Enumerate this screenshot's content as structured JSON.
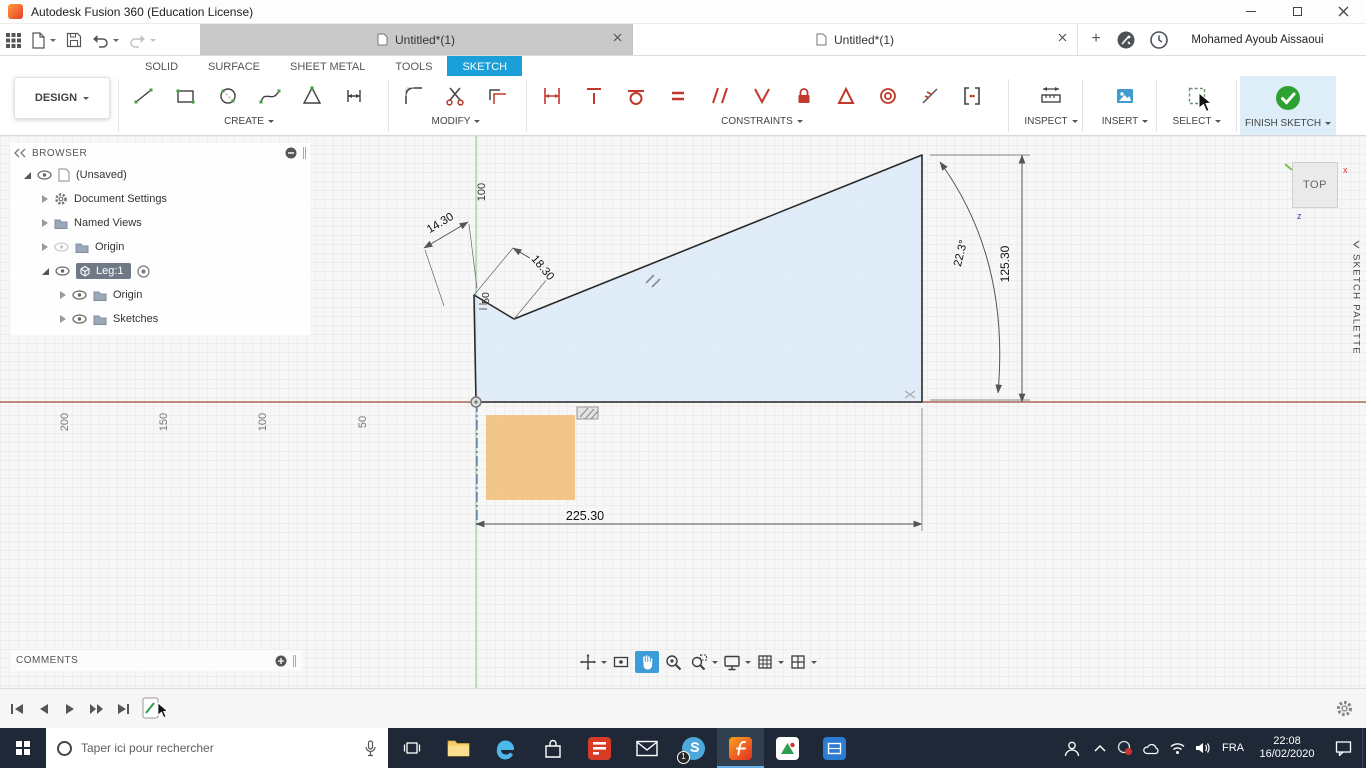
{
  "titlebar": {
    "title": "Autodesk Fusion 360 (Education License)"
  },
  "tabstrip": {
    "tabs": [
      {
        "label": "Untitled*(1)"
      },
      {
        "label": "Untitled*(1)"
      }
    ],
    "new_tab_label": "+",
    "username": "Mohamed Ayoub Aissaoui"
  },
  "ribbon": {
    "design_label": "DESIGN",
    "tabs": [
      "SOLID",
      "SURFACE",
      "SHEET METAL",
      "TOOLS",
      "SKETCH"
    ],
    "groups": {
      "create": "CREATE",
      "modify": "MODIFY",
      "constraints": "CONSTRAINTS",
      "inspect": "INSPECT",
      "insert": "INSERT",
      "select": "SELECT",
      "finish": "FINISH SKETCH"
    }
  },
  "browser": {
    "header": "BROWSER",
    "rows": [
      {
        "label": "(Unsaved)"
      },
      {
        "label": "Document Settings"
      },
      {
        "label": "Named Views"
      },
      {
        "label": "Origin"
      },
      {
        "label": "Leg:1"
      },
      {
        "label": "Origin"
      },
      {
        "label": "Sketches"
      }
    ]
  },
  "canvas": {
    "viewcube_face": "TOP",
    "axis_x": "x",
    "axis_z": "z",
    "palette_label": "SKETCH PALETTE",
    "ruler_labels": [
      "200",
      "150",
      "100",
      "50"
    ],
    "dimensions": {
      "seg_a": "14.30",
      "ref_height": "100",
      "notch": "18.30",
      "left_edge": "50",
      "angle": "22.3°",
      "right_height": "125.30",
      "base_width": "225.30"
    }
  },
  "comments": {
    "label": "COMMENTS"
  },
  "taskbar": {
    "search_placeholder": "Taper ici pour rechercher",
    "language": "FRA",
    "time": "22:08",
    "date": "16/02/2020",
    "skype_badge": "1"
  },
  "colors": {
    "accent_blue": "#1a9fd9",
    "finish_green": "#2fa132",
    "constraint_red": "#c0392b",
    "axis_red": "#a0453a",
    "axis_green": "#8fbf8f",
    "profile_fill": "#d9e8f7",
    "taskbar_bg": "#1e2836"
  }
}
